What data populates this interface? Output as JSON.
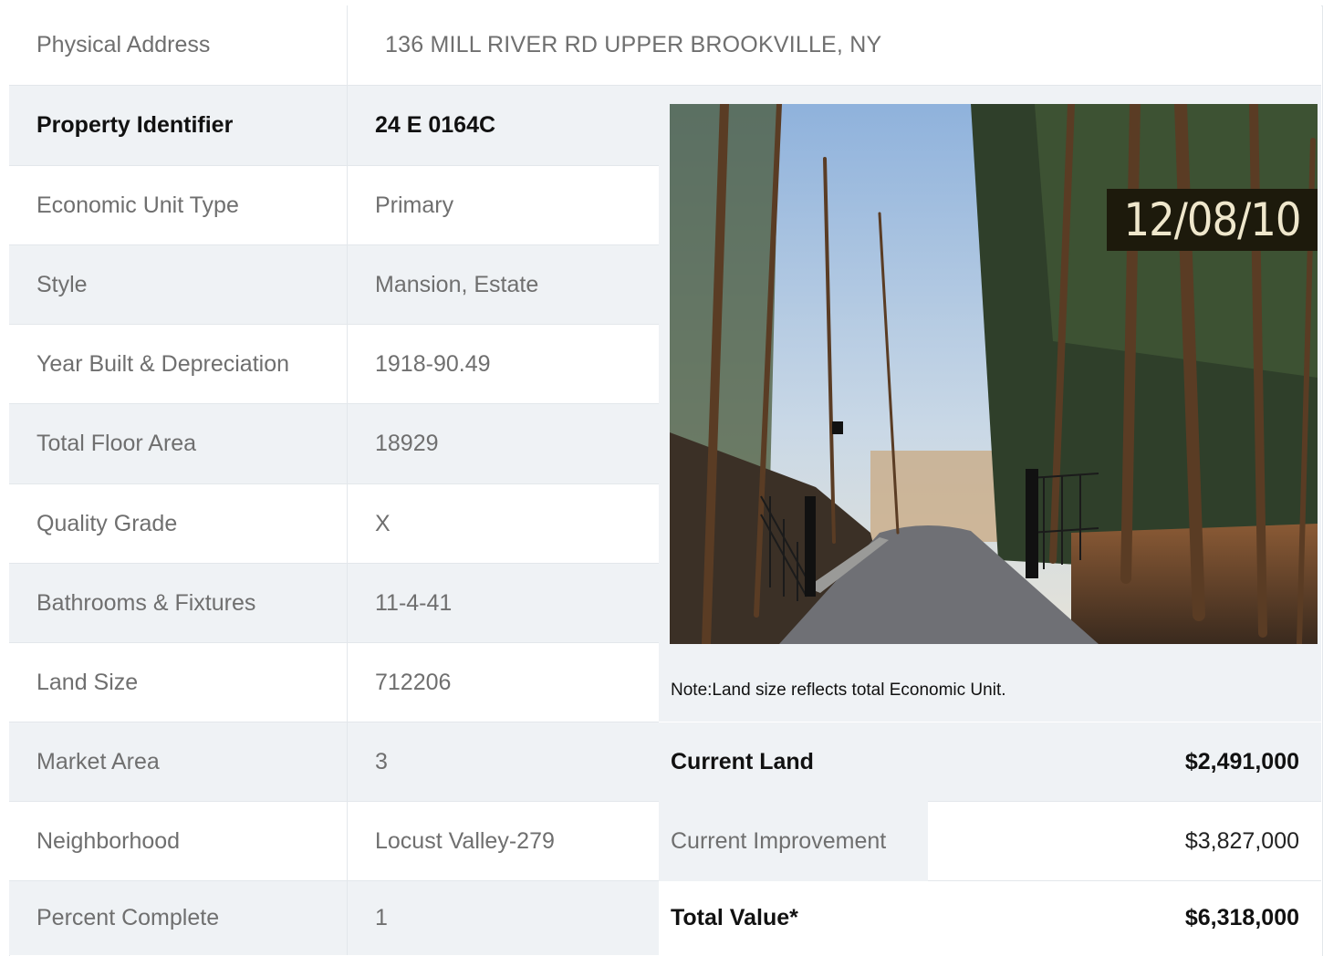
{
  "address": {
    "label": "Physical Address",
    "value": "136  MILL RIVER RD  UPPER BROOKVILLE, NY"
  },
  "rows": [
    {
      "label": "Property Identifier",
      "value": "24  E  0164C"
    },
    {
      "label": "Economic Unit Type",
      "value": "Primary"
    },
    {
      "label": "Style",
      "value": "Mansion, Estate"
    },
    {
      "label": "Year Built & Depreciation",
      "value": "1918-90.49"
    },
    {
      "label": "Total Floor Area",
      "value": "18929"
    },
    {
      "label": "Quality Grade",
      "value": "X"
    },
    {
      "label": "Bathrooms & Fixtures",
      "value": "11-4-41"
    },
    {
      "label": "Land Size",
      "value": "712206"
    },
    {
      "label": "Market Area",
      "value": "3"
    },
    {
      "label": "Neighborhood",
      "value": "Locust Valley-279"
    },
    {
      "label": "Percent Complete",
      "value": "1"
    }
  ],
  "photo": {
    "date_stamp": "12/08/10"
  },
  "note": "Note:Land size reflects total Economic Unit.",
  "values": [
    {
      "label": "Current Land",
      "value": "$2,491,000"
    },
    {
      "label": "Current Improvement",
      "value": "$3,827,000"
    },
    {
      "label": "Total Value*",
      "value": "$6,318,000"
    }
  ],
  "colors": {
    "row_shade": "#eff2f5",
    "border": "#e3e7eb",
    "label_text": "#6f6f6f",
    "bold_text": "#111111"
  }
}
